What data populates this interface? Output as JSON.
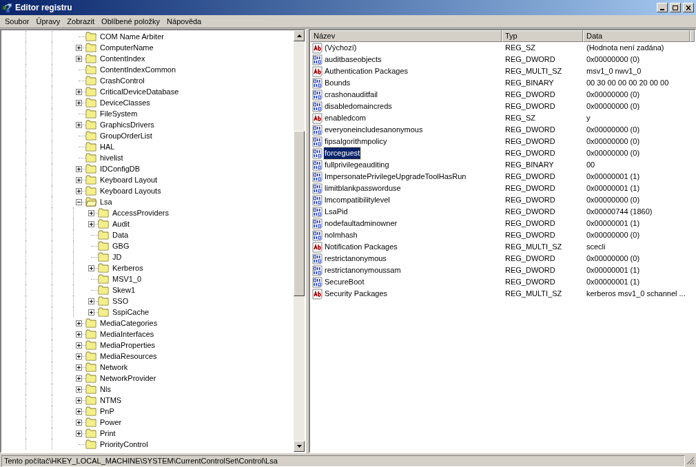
{
  "window": {
    "title": "Editor registru"
  },
  "menu": [
    {
      "label": "Soubor"
    },
    {
      "label": "Úpravy"
    },
    {
      "label": "Zobrazit"
    },
    {
      "label": "Oblíbené položky"
    },
    {
      "label": "Nápověda"
    }
  ],
  "tree": [
    {
      "label": "COM Name Arbiter",
      "has_children": false,
      "expanded": false
    },
    {
      "label": "ComputerName",
      "has_children": true,
      "expanded": false
    },
    {
      "label": "ContentIndex",
      "has_children": true,
      "expanded": false
    },
    {
      "label": "ContentIndexCommon",
      "has_children": false,
      "expanded": false
    },
    {
      "label": "CrashControl",
      "has_children": false,
      "expanded": false
    },
    {
      "label": "CriticalDeviceDatabase",
      "has_children": true,
      "expanded": false
    },
    {
      "label": "DeviceClasses",
      "has_children": true,
      "expanded": false
    },
    {
      "label": "FileSystem",
      "has_children": false,
      "expanded": false
    },
    {
      "label": "GraphicsDrivers",
      "has_children": true,
      "expanded": false
    },
    {
      "label": "GroupOrderList",
      "has_children": false,
      "expanded": false
    },
    {
      "label": "HAL",
      "has_children": false,
      "expanded": false
    },
    {
      "label": "hivelist",
      "has_children": false,
      "expanded": false
    },
    {
      "label": "IDConfigDB",
      "has_children": true,
      "expanded": false
    },
    {
      "label": "Keyboard Layout",
      "has_children": true,
      "expanded": false
    },
    {
      "label": "Keyboard Layouts",
      "has_children": true,
      "expanded": false
    },
    {
      "label": "Lsa",
      "has_children": true,
      "expanded": true,
      "children": [
        {
          "label": "AccessProviders",
          "has_children": true,
          "expanded": false
        },
        {
          "label": "Audit",
          "has_children": true,
          "expanded": false
        },
        {
          "label": "Data",
          "has_children": false,
          "expanded": false
        },
        {
          "label": "GBG",
          "has_children": false,
          "expanded": false
        },
        {
          "label": "JD",
          "has_children": false,
          "expanded": false
        },
        {
          "label": "Kerberos",
          "has_children": true,
          "expanded": false
        },
        {
          "label": "MSV1_0",
          "has_children": false,
          "expanded": false
        },
        {
          "label": "Skew1",
          "has_children": false,
          "expanded": false
        },
        {
          "label": "SSO",
          "has_children": true,
          "expanded": false
        },
        {
          "label": "SspiCache",
          "has_children": true,
          "expanded": false
        }
      ]
    },
    {
      "label": "MediaCategories",
      "has_children": true,
      "expanded": false
    },
    {
      "label": "MediaInterfaces",
      "has_children": true,
      "expanded": false
    },
    {
      "label": "MediaProperties",
      "has_children": true,
      "expanded": false
    },
    {
      "label": "MediaResources",
      "has_children": true,
      "expanded": false
    },
    {
      "label": "Network",
      "has_children": true,
      "expanded": false
    },
    {
      "label": "NetworkProvider",
      "has_children": true,
      "expanded": false
    },
    {
      "label": "Nls",
      "has_children": true,
      "expanded": false
    },
    {
      "label": "NTMS",
      "has_children": true,
      "expanded": false
    },
    {
      "label": "PnP",
      "has_children": true,
      "expanded": false
    },
    {
      "label": "Power",
      "has_children": true,
      "expanded": false
    },
    {
      "label": "Print",
      "has_children": true,
      "expanded": false
    },
    {
      "label": "PriorityControl",
      "has_children": false,
      "expanded": false
    }
  ],
  "values": {
    "columns": [
      "Název",
      "Typ",
      "Data"
    ],
    "rows": [
      {
        "kind": "string",
        "name": "(Výchozí)",
        "type": "REG_SZ",
        "data": "(Hodnota není zadána)",
        "selected": false
      },
      {
        "kind": "binary",
        "name": "auditbaseobjects",
        "type": "REG_DWORD",
        "data": "0x00000000 (0)",
        "selected": false
      },
      {
        "kind": "string",
        "name": "Authentication Packages",
        "type": "REG_MULTI_SZ",
        "data": "msv1_0 nwv1_0",
        "selected": false
      },
      {
        "kind": "binary",
        "name": "Bounds",
        "type": "REG_BINARY",
        "data": "00 30 00 00 00 20 00 00",
        "selected": false
      },
      {
        "kind": "binary",
        "name": "crashonauditfail",
        "type": "REG_DWORD",
        "data": "0x00000000 (0)",
        "selected": false
      },
      {
        "kind": "binary",
        "name": "disabledomaincreds",
        "type": "REG_DWORD",
        "data": "0x00000000 (0)",
        "selected": false
      },
      {
        "kind": "string",
        "name": "enabledcom",
        "type": "REG_SZ",
        "data": "y",
        "selected": false
      },
      {
        "kind": "binary",
        "name": "everyoneincludesanonymous",
        "type": "REG_DWORD",
        "data": "0x00000000 (0)",
        "selected": false
      },
      {
        "kind": "binary",
        "name": "fipsalgorithmpolicy",
        "type": "REG_DWORD",
        "data": "0x00000000 (0)",
        "selected": false
      },
      {
        "kind": "binary",
        "name": "forceguest",
        "type": "REG_DWORD",
        "data": "0x00000000 (0)",
        "selected": true
      },
      {
        "kind": "binary",
        "name": "fullprivilegeauditing",
        "type": "REG_BINARY",
        "data": "00",
        "selected": false
      },
      {
        "kind": "binary",
        "name": "ImpersonatePrivilegeUpgradeToolHasRun",
        "type": "REG_DWORD",
        "data": "0x00000001 (1)",
        "selected": false
      },
      {
        "kind": "binary",
        "name": "limitblankpassworduse",
        "type": "REG_DWORD",
        "data": "0x00000001 (1)",
        "selected": false
      },
      {
        "kind": "binary",
        "name": "lmcompatibilitylevel",
        "type": "REG_DWORD",
        "data": "0x00000000 (0)",
        "selected": false
      },
      {
        "kind": "binary",
        "name": "LsaPid",
        "type": "REG_DWORD",
        "data": "0x00000744 (1860)",
        "selected": false
      },
      {
        "kind": "binary",
        "name": "nodefaultadminowner",
        "type": "REG_DWORD",
        "data": "0x00000001 (1)",
        "selected": false
      },
      {
        "kind": "binary",
        "name": "nolmhash",
        "type": "REG_DWORD",
        "data": "0x00000000 (0)",
        "selected": false
      },
      {
        "kind": "string",
        "name": "Notification Packages",
        "type": "REG_MULTI_SZ",
        "data": "scecli",
        "selected": false
      },
      {
        "kind": "binary",
        "name": "restrictanonymous",
        "type": "REG_DWORD",
        "data": "0x00000000 (0)",
        "selected": false
      },
      {
        "kind": "binary",
        "name": "restrictanonymoussam",
        "type": "REG_DWORD",
        "data": "0x00000001 (1)",
        "selected": false
      },
      {
        "kind": "binary",
        "name": "SecureBoot",
        "type": "REG_DWORD",
        "data": "0x00000001 (1)",
        "selected": false
      },
      {
        "kind": "string",
        "name": "Security Packages",
        "type": "REG_MULTI_SZ",
        "data": "kerberos msv1_0 schannel ...",
        "selected": false
      }
    ]
  },
  "status_bar": "Tento počítač\\HKEY_LOCAL_MACHINE\\SYSTEM\\CurrentControlSet\\Control\\Lsa"
}
